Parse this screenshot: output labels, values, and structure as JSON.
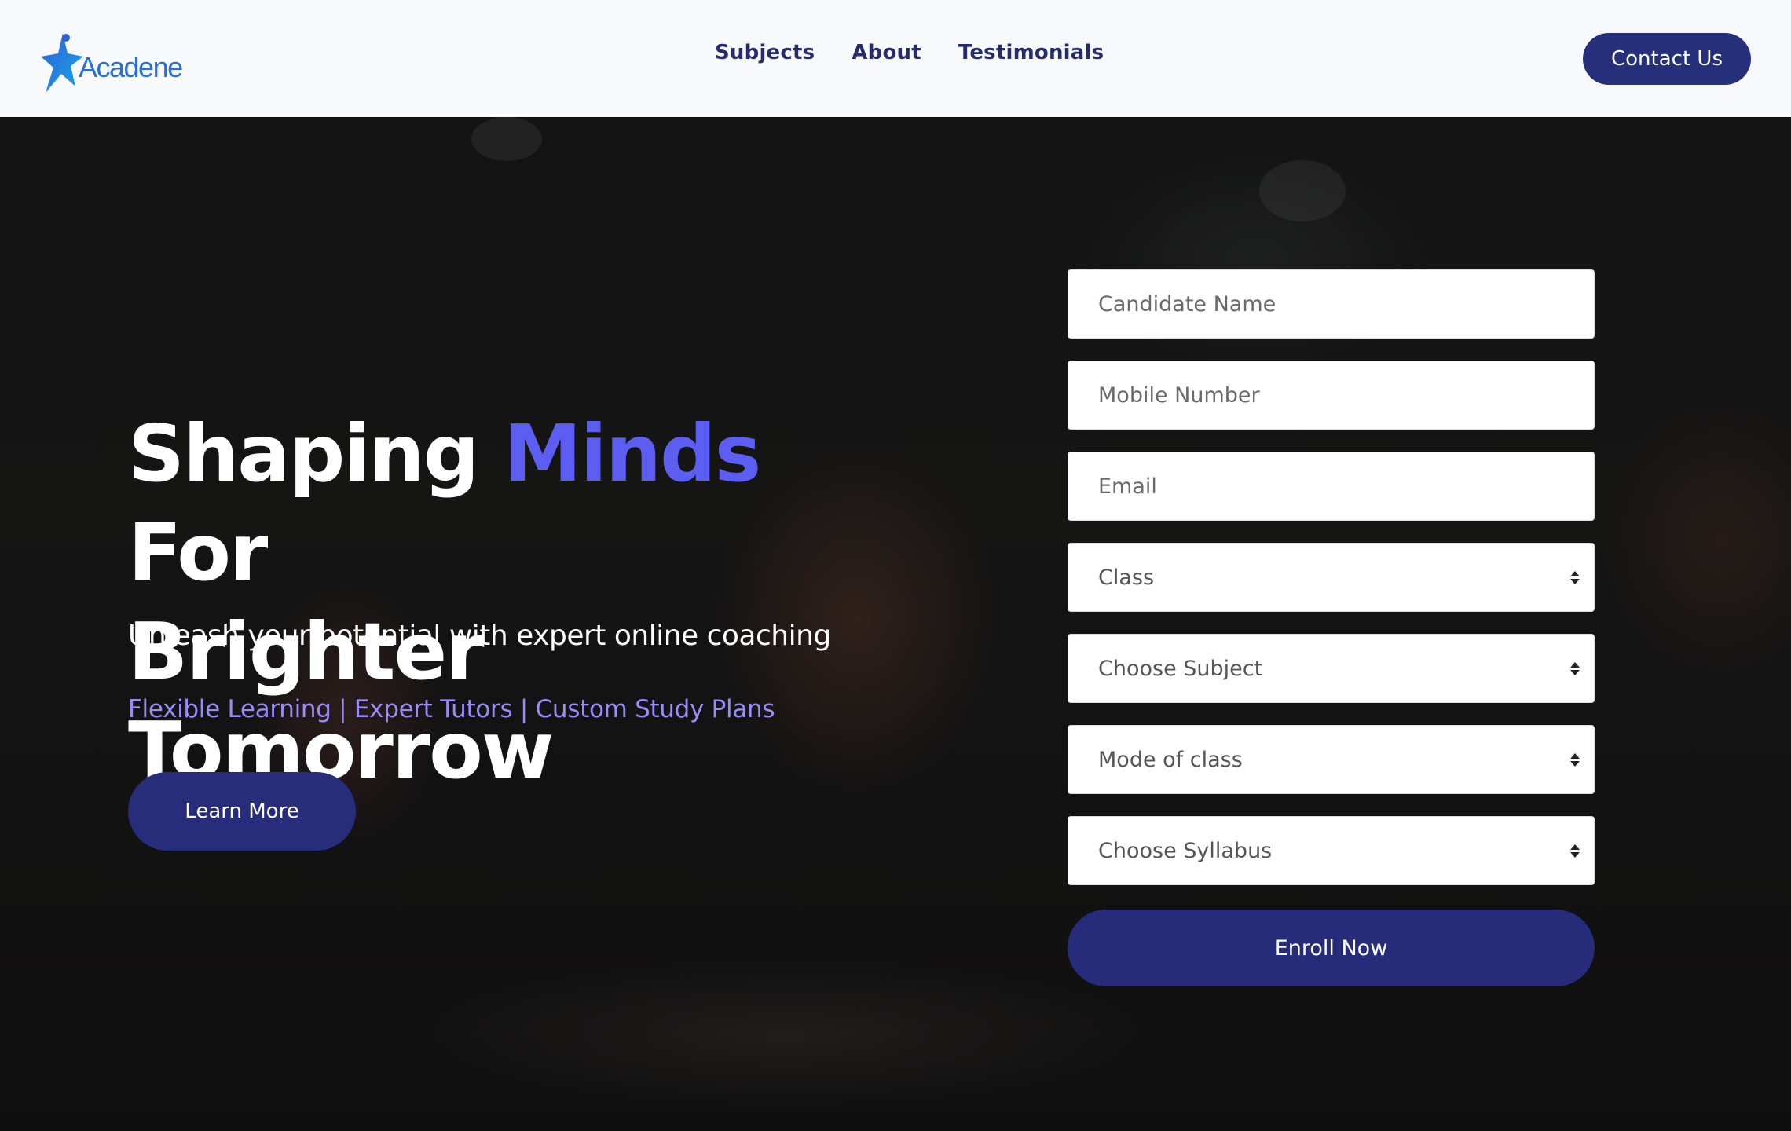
{
  "brand": {
    "name": "Acadene",
    "logo_icon": "star-person-icon",
    "colors": {
      "primary": "#262c79",
      "accent": "#5b5ef0",
      "logo": "#2b6fd6"
    }
  },
  "nav": {
    "items": [
      {
        "label": "Subjects"
      },
      {
        "label": "About"
      },
      {
        "label": "Testimonials"
      }
    ]
  },
  "header": {
    "contact_label": "Contact Us"
  },
  "hero": {
    "title_part1": "Shaping ",
    "title_accent": "Minds",
    "title_part2": " For",
    "title_line2": "Brighter Tomorrow",
    "subtitle": "Unleash your potential with expert online coaching",
    "features": "Flexible Learning | Expert Tutors | Custom Study Plans",
    "learn_more_label": "Learn More"
  },
  "form": {
    "candidate_name_placeholder": "Candidate Name",
    "mobile_placeholder": "Mobile Number",
    "email_placeholder": "Email",
    "class_value": "Class",
    "subject_value": "Choose Subject",
    "mode_value": "Mode of class",
    "syllabus_value": "Choose Syllabus",
    "enroll_label": "Enroll Now"
  }
}
